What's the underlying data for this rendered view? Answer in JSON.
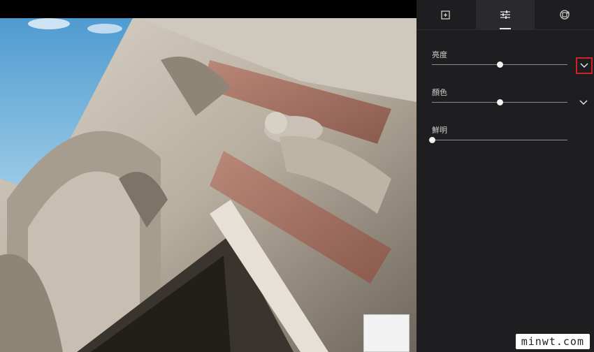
{
  "tabs": [
    {
      "icon": "crop-add-icon",
      "active": false
    },
    {
      "icon": "sliders-icon",
      "active": true
    },
    {
      "icon": "rotate-icon",
      "active": false
    }
  ],
  "adjustments": [
    {
      "label": "亮度",
      "value": 0.5,
      "expanded_highlight": true
    },
    {
      "label": "顏色",
      "value": 0.5,
      "expanded_highlight": false
    },
    {
      "label": "鮮明",
      "value": 0.0,
      "expanded_highlight": null
    }
  ],
  "watermark": "minwt.com",
  "colors": {
    "panel_bg": "#1e1e21",
    "highlight_border": "#d0202a",
    "thumb": "#f2f2f2"
  }
}
